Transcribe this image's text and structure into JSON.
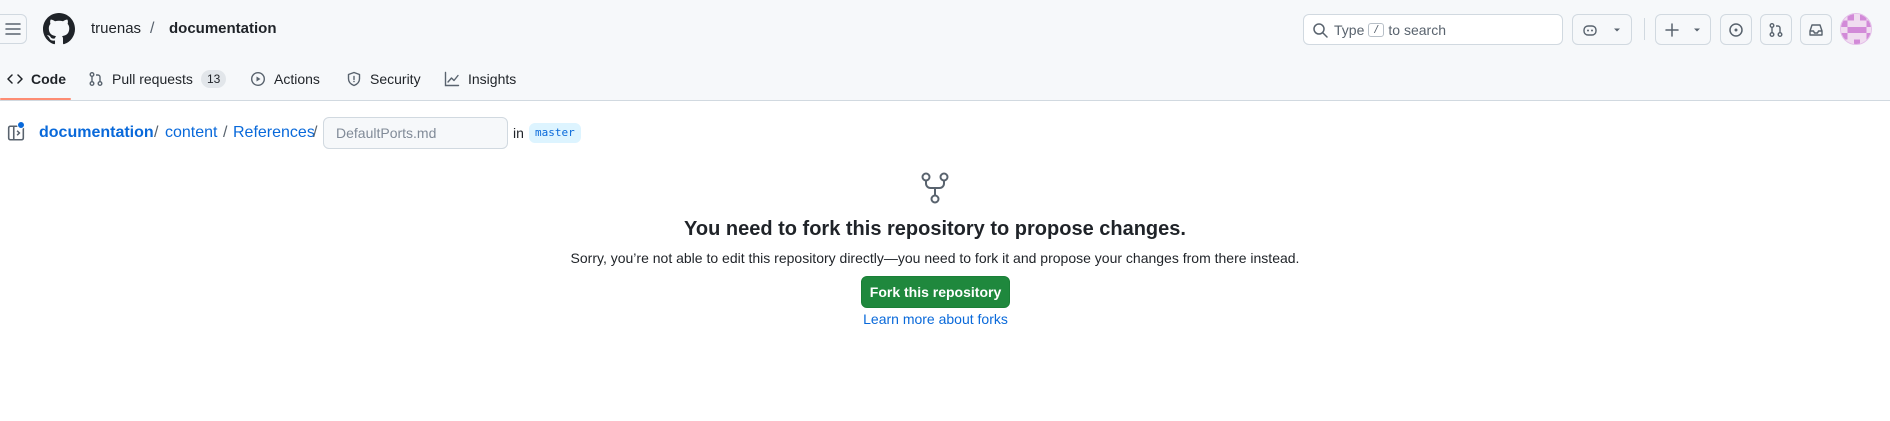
{
  "header": {
    "owner": "truenas",
    "separator": "/",
    "repo": "documentation",
    "search_prefix": "Type",
    "search_key": "/",
    "search_suffix": "to search"
  },
  "tabs": [
    {
      "label": "Code",
      "icon": "code-icon",
      "active": true
    },
    {
      "label": "Pull requests",
      "icon": "git-pull-request-icon",
      "counter": "13"
    },
    {
      "label": "Actions",
      "icon": "play-icon"
    },
    {
      "label": "Security",
      "icon": "shield-icon"
    },
    {
      "label": "Insights",
      "icon": "graph-icon"
    }
  ],
  "breadcrumb": {
    "repo": "documentation",
    "sep": "/",
    "path": [
      "content",
      "References"
    ],
    "filename_placeholder": "DefaultPorts.md",
    "in_label": "in",
    "branch": "master"
  },
  "blankslate": {
    "icon": "repo-forked-icon",
    "title": "You need to fork this repository to propose changes.",
    "description": "Sorry, you’re not able to edit this repository directly—you need to fork it and propose your changes from there instead.",
    "button_label": "Fork this repository",
    "link_label": "Learn more about forks"
  },
  "colors": {
    "accent": "#0969da",
    "primary_button": "#1f883d",
    "tab_underline": "#fd8c73"
  }
}
